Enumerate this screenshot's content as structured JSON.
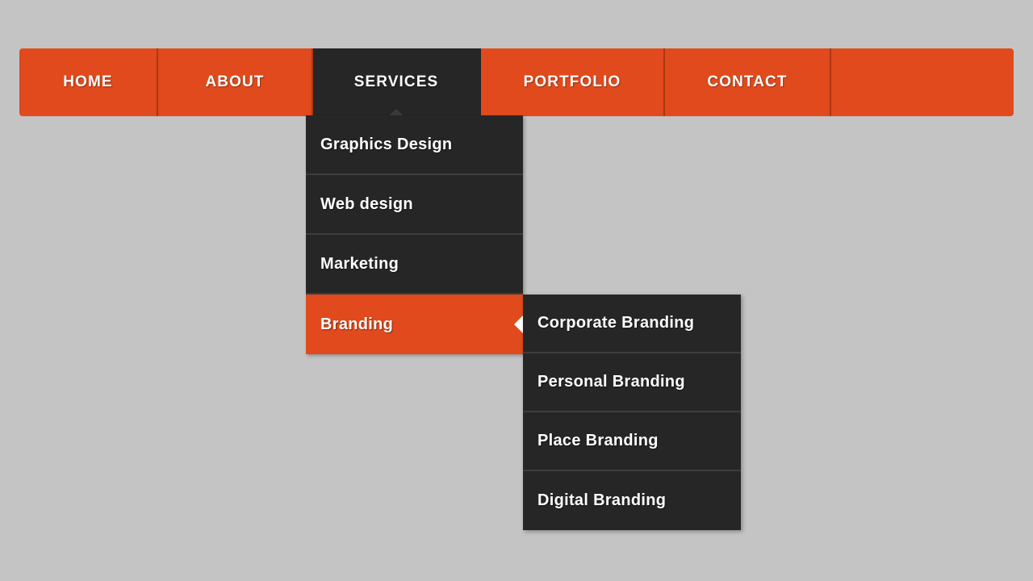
{
  "colors": {
    "page_background": "#c4c4c4",
    "accent_orange": "#e04a1c",
    "dark_panel": "#262626",
    "divider_orange": "#ab3714",
    "divider_dark": "#3d3d3d",
    "text": "#ffffff"
  },
  "navbar": {
    "items": [
      {
        "label": "HOME",
        "active": false
      },
      {
        "label": "ABOUT",
        "active": false
      },
      {
        "label": "SERVICES",
        "active": true
      },
      {
        "label": "PORTFOLIO",
        "active": false
      },
      {
        "label": "CONTACT",
        "active": false
      }
    ]
  },
  "dropdown": {
    "parent": "SERVICES",
    "items": [
      {
        "label": "Graphics Design",
        "active": false,
        "has_submenu": false
      },
      {
        "label": "Web design",
        "active": false,
        "has_submenu": false
      },
      {
        "label": "Marketing",
        "active": false,
        "has_submenu": false
      },
      {
        "label": "Branding",
        "active": true,
        "has_submenu": true
      }
    ]
  },
  "submenu": {
    "parent": "Branding",
    "items": [
      {
        "label": "Corporate Branding"
      },
      {
        "label": "Personal Branding"
      },
      {
        "label": "Place Branding"
      },
      {
        "label": "Digital Branding"
      }
    ]
  },
  "icons": {
    "caret_down": "caret-down-icon",
    "submenu_arrow": "caret-left-icon"
  }
}
